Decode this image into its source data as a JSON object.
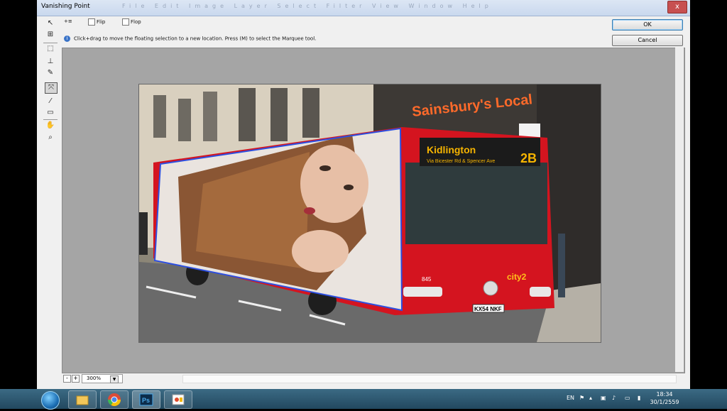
{
  "window": {
    "title": "Vanishing Point",
    "close_label": "x",
    "faded_menu": "File Edit Image Layer Select Filter View Window Help"
  },
  "options": {
    "flip_label": "Flip",
    "flop_label": "Flop",
    "heal_icon": "heal-icon"
  },
  "hint": {
    "text": "Click+drag to move the floating selection to a new location. Press (M) to select the Marquee tool."
  },
  "buttons": {
    "ok": "OK",
    "cancel": "Cancel"
  },
  "zoom": {
    "value": "300%",
    "minus": "-",
    "plus": "+"
  },
  "photo": {
    "destination": "Kidlington",
    "via": "Via Bicester Rd & Spencer Ave",
    "route": "2B",
    "store_sign": "Sainsbury's Local",
    "fleet_no": "845",
    "brand": "city2",
    "plate": "KX54 NKF"
  },
  "taskbar": {
    "lang": "EN",
    "time": "18:34",
    "date": "30/1/2559"
  },
  "colors": {
    "bus_red": "#d4141f",
    "selection_blue": "#2d4fe0",
    "dialog_bg": "#f0f0f0",
    "canvas_bg": "#a5a5a5"
  }
}
